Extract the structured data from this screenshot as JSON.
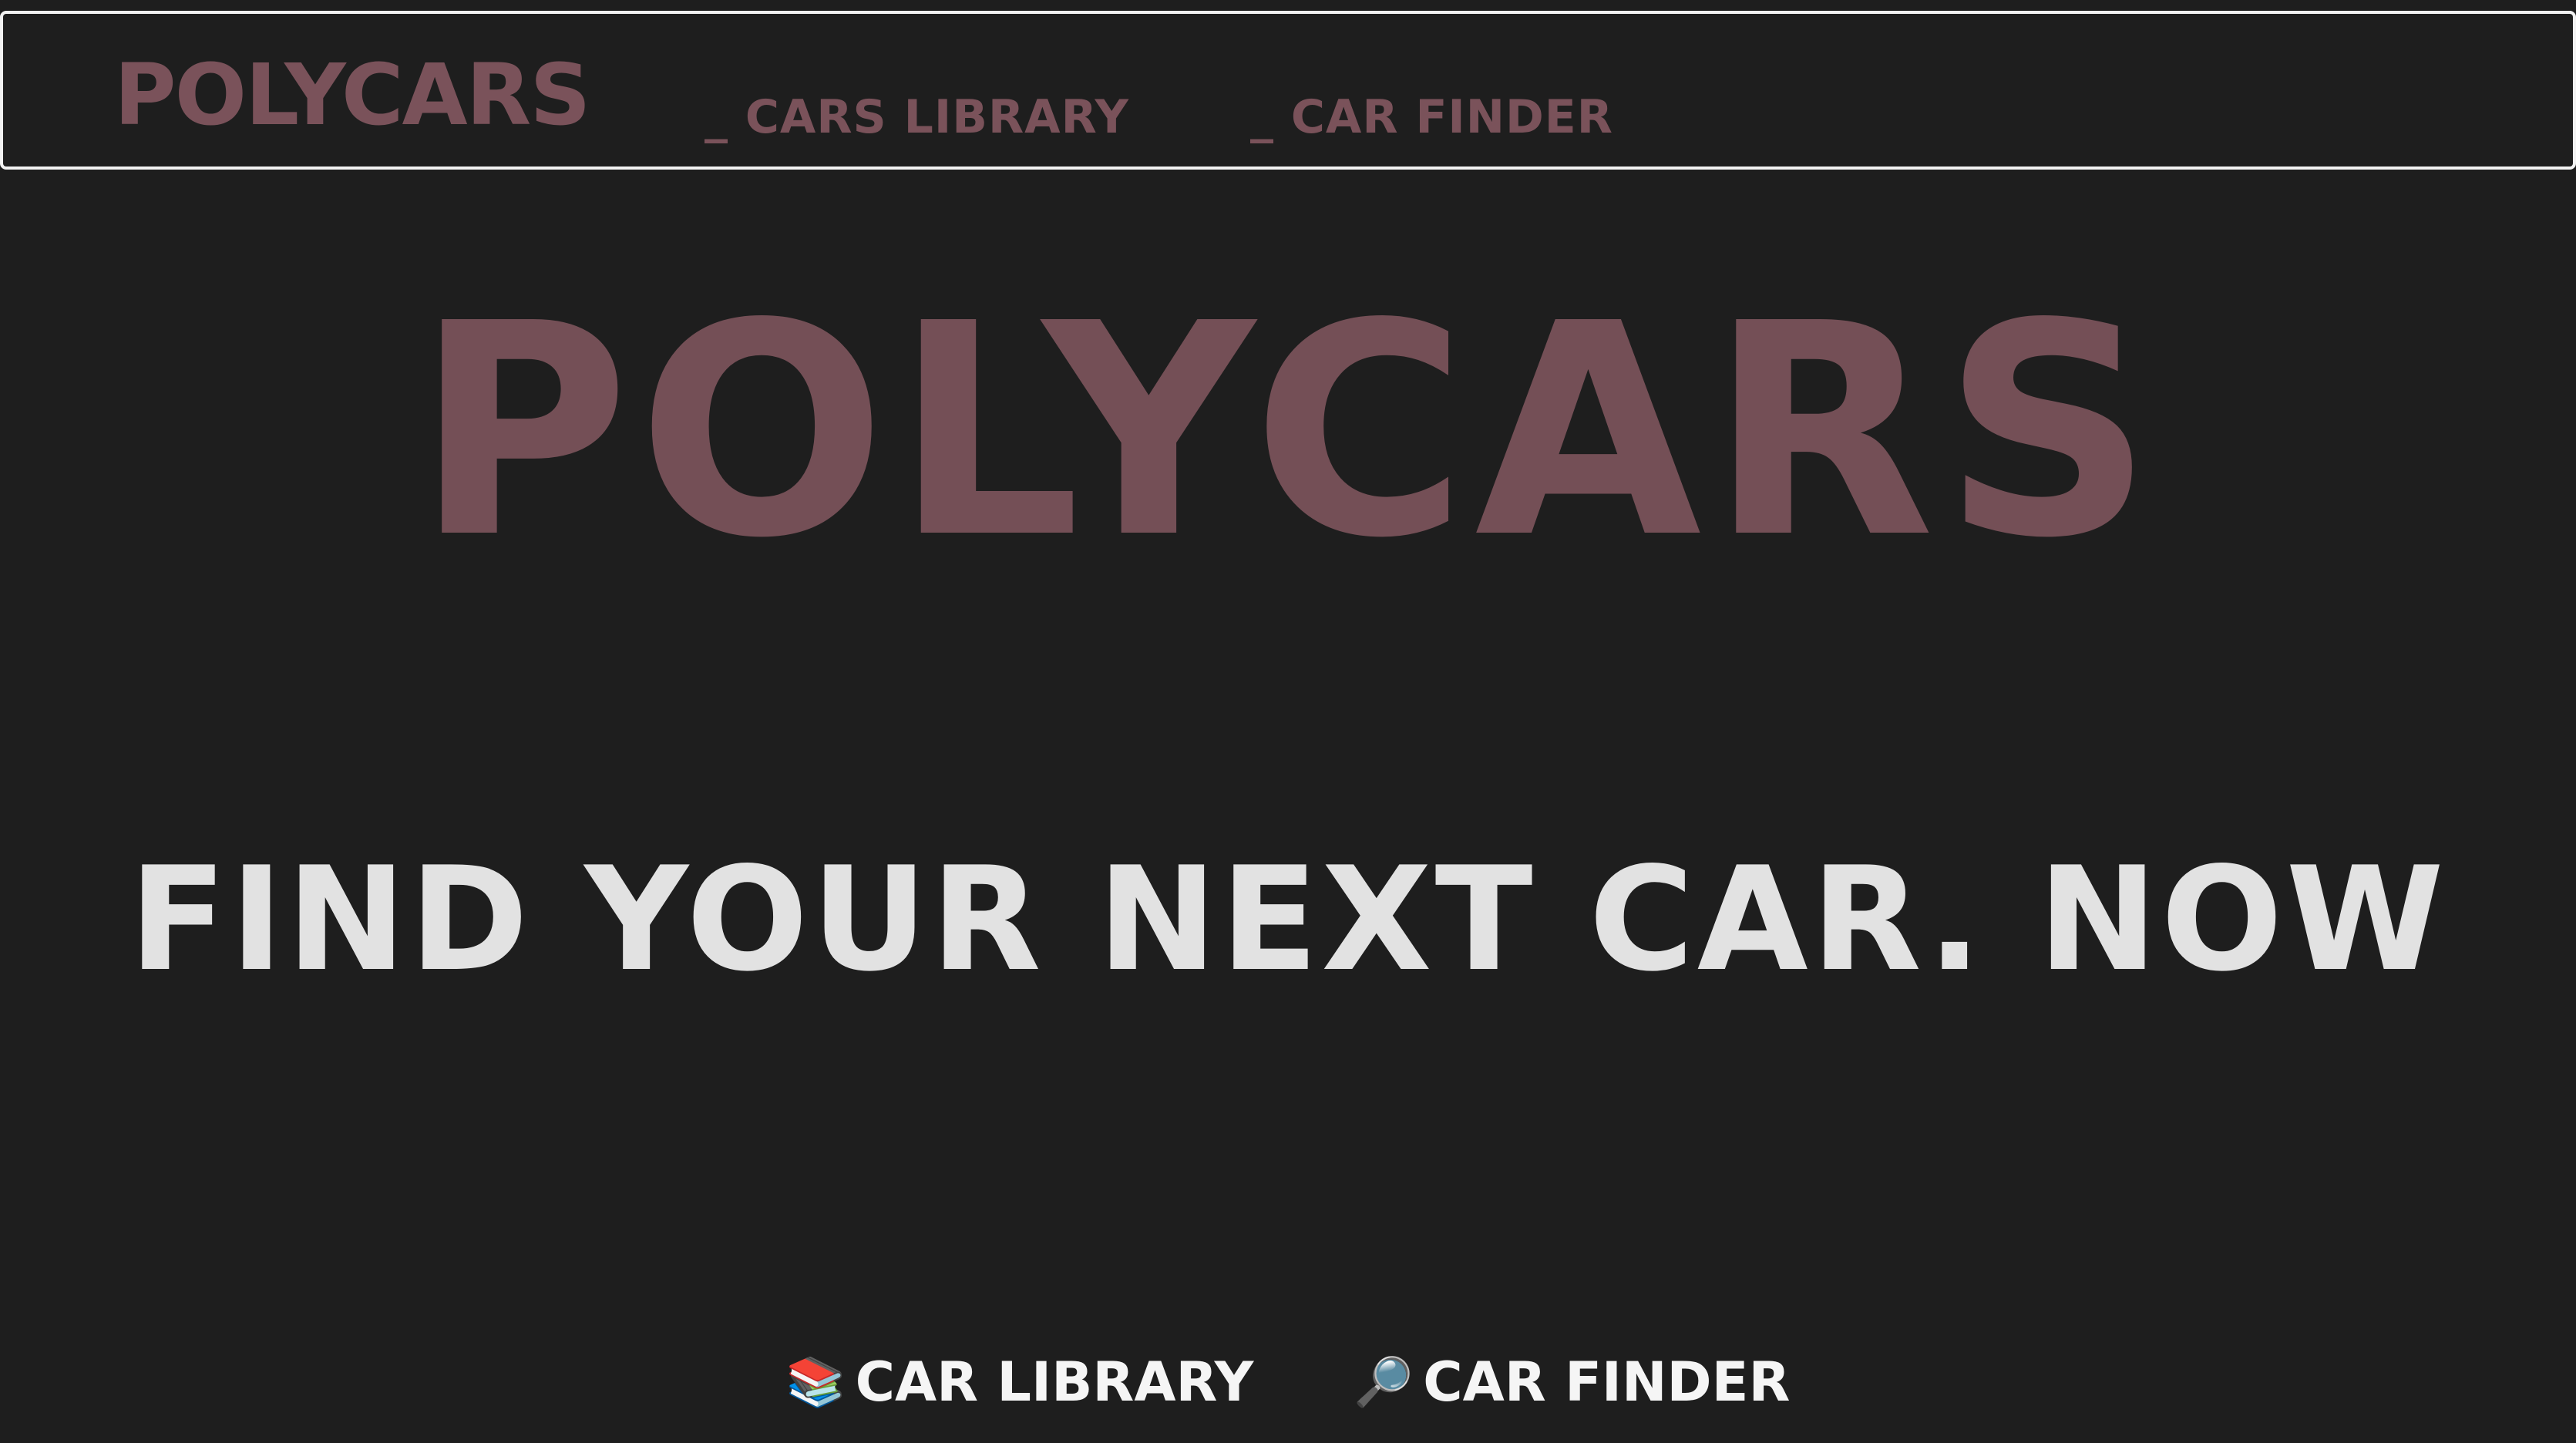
{
  "colors": {
    "background": "#1e1e1e",
    "brand": "#744f56",
    "nav_border": "#f2f2f2",
    "tagline": "#e2e2e2",
    "bottom_link": "#f5f5f5"
  },
  "nav": {
    "brand": "POLYCARS",
    "links": [
      {
        "label": "_ CARS LIBRARY"
      },
      {
        "label": "_ CAR FINDER"
      }
    ]
  },
  "hero": {
    "title": "POLYCARS",
    "tagline": "FIND YOUR NEXT CAR. NOW"
  },
  "bottom_links": [
    {
      "icon": "📚",
      "icon_name": "books-icon",
      "label": "CAR LIBRARY"
    },
    {
      "icon": "🔎",
      "icon_name": "magnifying-glass-icon",
      "label": "CAR FINDER"
    }
  ]
}
